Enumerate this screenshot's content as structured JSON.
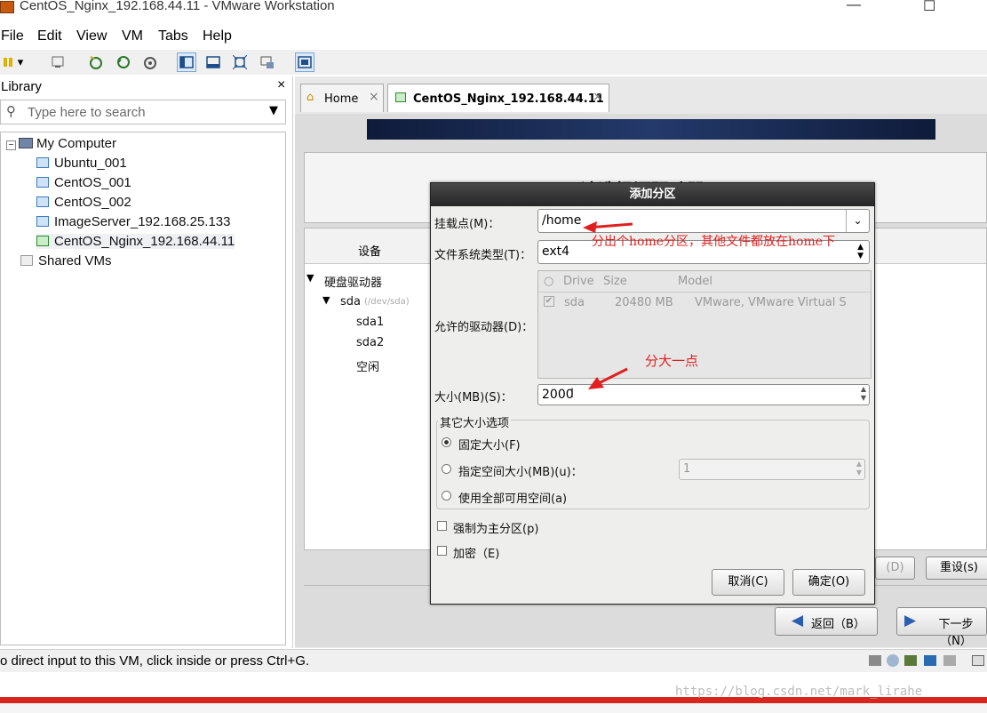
{
  "window": {
    "title": "CentOS_Nginx_192.168.44.11 - VMware Workstation"
  },
  "menu": [
    "File",
    "Edit",
    "View",
    "VM",
    "Tabs",
    "Help"
  ],
  "library": {
    "title": "Library",
    "search_placeholder": "Type here to search",
    "root": "My Computer",
    "vms": [
      "Ubuntu_001",
      "CentOS_001",
      "CentOS_002",
      "ImageServer_192.168.25.133",
      "CentOS_Nginx_192.168.44.11"
    ],
    "shared": "Shared VMs"
  },
  "tabs": [
    "Home",
    "CentOS_Nginx_192.168.44.11"
  ],
  "guest": {
    "heading_partial": "请选择源驱动器",
    "device_header": "设备",
    "tree": {
      "hdd": "硬盘驱动器",
      "sda": "sda",
      "sda_path": "(/dev/sda)",
      "sda1": "sda1",
      "sda2": "sda2",
      "free": "空闲"
    },
    "btn_delete_partial": "(D)",
    "btn_reset": "重设(s)",
    "btn_back": "返回（B）",
    "btn_next": "下一步（N）"
  },
  "dialog": {
    "title": "添加分区",
    "mount_label": "挂载点(M)：",
    "mount_value": "/home",
    "fstype_label": "文件系统类型(T)：",
    "fstype_value": "ext4",
    "drives_label": "允许的驱动器(D)：",
    "drive_columns": [
      "Drive",
      "Size",
      "Model"
    ],
    "drive_row": {
      "drive": "sda",
      "size": "20480 MB",
      "model": "VMware, VMware Virtual S"
    },
    "size_label": "大小(MB)(S)：",
    "size_value": "2000",
    "options_group": "其它大小选项",
    "opt_fixed": "固定大小(F)",
    "opt_upto": "指定空间大小(MB)(u)：",
    "opt_upto_value": "1",
    "opt_fill": "使用全部可用空间(a)",
    "force_primary": "强制为主分区(p)",
    "encrypt": "加密（E)",
    "cancel": "取消(C)",
    "ok": "确定(O)"
  },
  "annotations": {
    "home_note": "分出个home分区，其他文件都放在home下",
    "size_note": "分大一点",
    "color": "#e02020"
  },
  "status": {
    "text": "o direct input to this VM, click inside or press Ctrl+G."
  },
  "watermark": "https://blog.csdn.net/mark_lirahe"
}
